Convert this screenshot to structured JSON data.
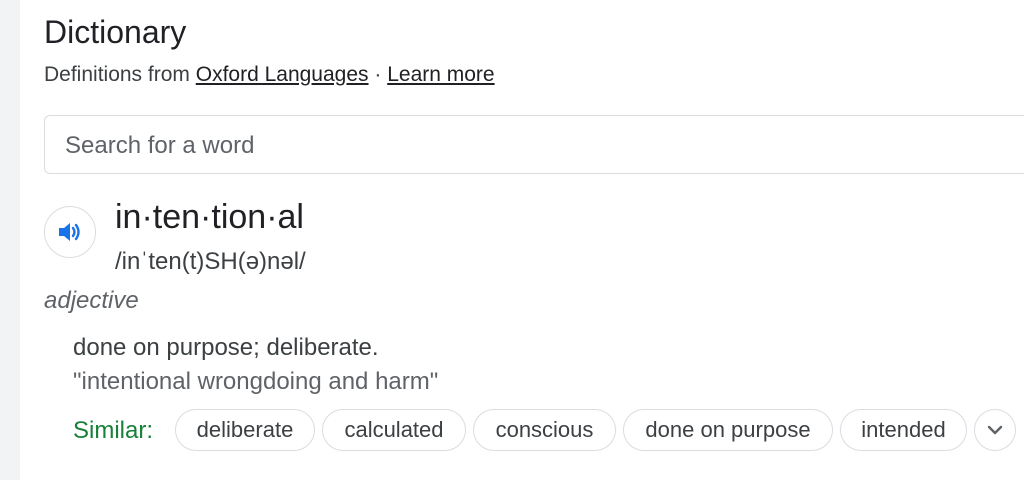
{
  "header": {
    "title": "Dictionary",
    "source_prefix": "Definitions from",
    "source_link": "Oxford Languages",
    "separator": "·",
    "learn_more": "Learn more"
  },
  "search": {
    "placeholder": "Search for a word"
  },
  "entry": {
    "speaker_icon": "speaker-icon",
    "word": "in·ten·tion·al",
    "phonetic": "/inˈten(t)SH(ə)nəl/",
    "part_of_speech": "adjective",
    "definition": "done on purpose; deliberate.",
    "example": "\"intentional wrongdoing and harm\"",
    "similar_label": "Similar:",
    "similar": [
      "deliberate",
      "calculated",
      "conscious",
      "done on purpose",
      "intended"
    ],
    "more_icon": "chevron-down-icon"
  },
  "colors": {
    "accent_blue": "#1a73e8",
    "similar_green": "#188038",
    "text_primary": "#202124",
    "text_secondary": "#5f6368",
    "border": "#dadce0"
  }
}
